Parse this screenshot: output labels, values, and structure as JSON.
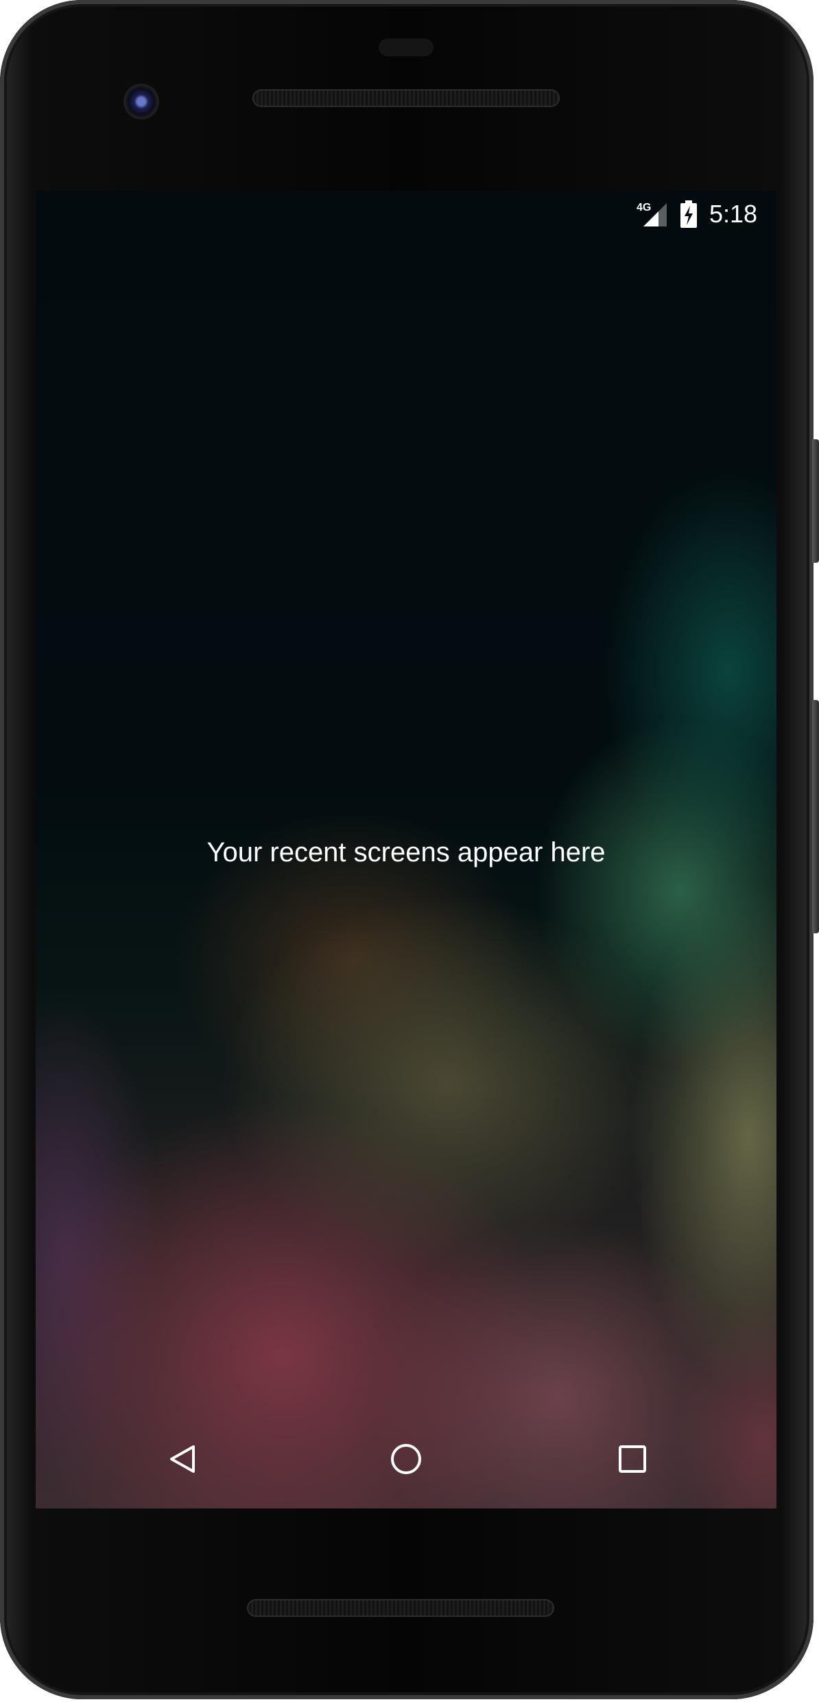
{
  "status_bar": {
    "network_type": "4G",
    "signal_icon": "cell-signal-icon",
    "battery_icon": "battery-charging-icon",
    "time": "5:18"
  },
  "overview": {
    "empty_message": "Your recent screens appear here"
  },
  "nav_bar": {
    "back_icon": "back-triangle-icon",
    "home_icon": "home-circle-icon",
    "overview_icon": "overview-square-icon"
  },
  "colors": {
    "text": "#ffffff",
    "wallpaper_base": "#030b0e"
  }
}
